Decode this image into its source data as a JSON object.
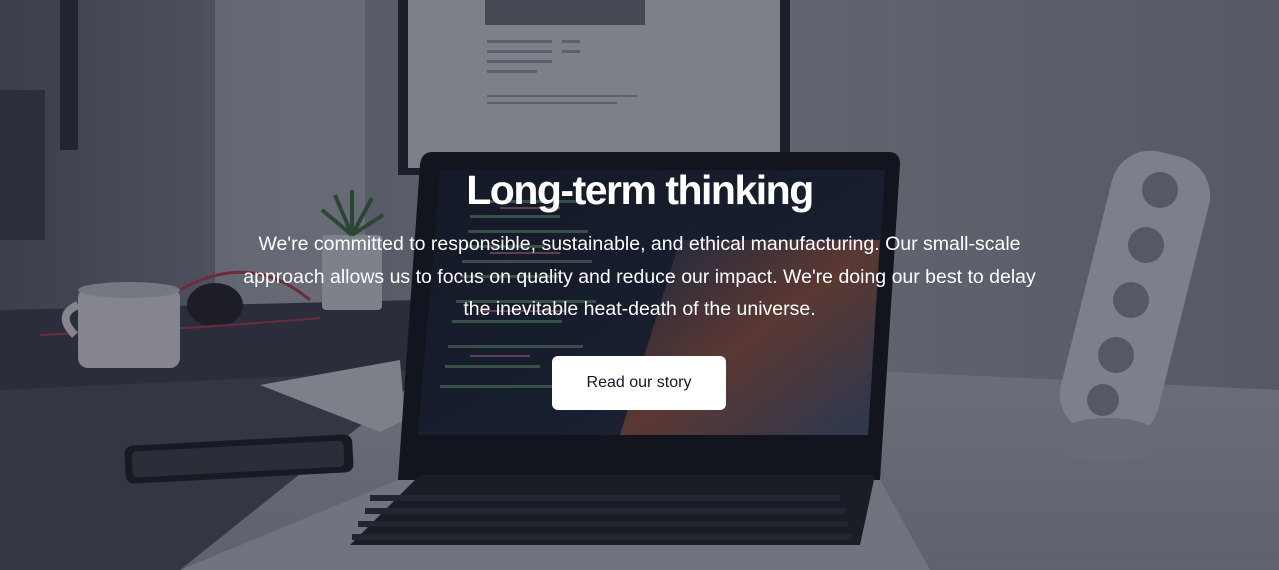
{
  "hero": {
    "title": "Long-term thinking",
    "description": "We're committed to responsible, sustainable, and ethical manufacturing. Our small-scale approach allows us to focus on quality and reduce our impact. We're doing our best to delay the inevitable heat-death of the universe.",
    "cta_label": "Read our story"
  }
}
